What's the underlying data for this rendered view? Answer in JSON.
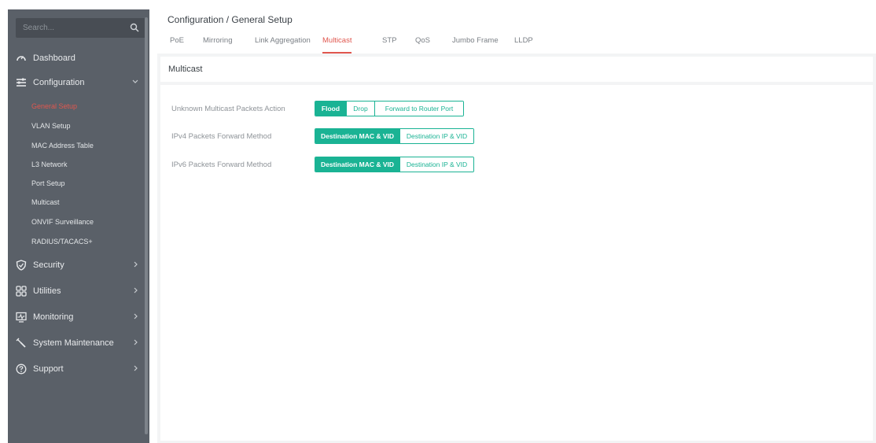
{
  "sidebar": {
    "search_placeholder": "Search...",
    "items": [
      {
        "label": "Dashboard",
        "icon": "dashboard-gauge-icon"
      },
      {
        "label": "Configuration",
        "icon": "list-settings-icon",
        "expanded": true
      },
      {
        "label": "Security",
        "icon": "shield-icon"
      },
      {
        "label": "Utilities",
        "icon": "grid-icon"
      },
      {
        "label": "Monitoring",
        "icon": "monitor-icon"
      },
      {
        "label": "System Maintenance",
        "icon": "wrench-icon"
      },
      {
        "label": "Support",
        "icon": "help-icon"
      }
    ],
    "config_subitems": [
      {
        "label": "General Setup",
        "active": true
      },
      {
        "label": "VLAN Setup"
      },
      {
        "label": "MAC Address Table"
      },
      {
        "label": "L3 Network"
      },
      {
        "label": "Port Setup"
      },
      {
        "label": "Multicast"
      },
      {
        "label": "ONVIF Surveillance"
      },
      {
        "label": "RADIUS/TACACS+"
      }
    ]
  },
  "header": {
    "breadcrumb": "Configuration / General Setup"
  },
  "tabs": [
    {
      "label": "PoE"
    },
    {
      "label": "Mirroring"
    },
    {
      "label": "Link Aggregation"
    },
    {
      "label": "Multicast",
      "active": true
    },
    {
      "label": "STP"
    },
    {
      "label": "QoS"
    },
    {
      "label": "Jumbo Frame"
    },
    {
      "label": "LLDP"
    }
  ],
  "panel": {
    "title": "Multicast",
    "rows": [
      {
        "label": "Unknown Multicast Packets Action",
        "options": [
          "Flood",
          "Drop",
          "Forward to Router Port"
        ],
        "selected": "Flood"
      },
      {
        "label": "IPv4 Packets Forward Method",
        "options": [
          "Destination MAC & VID",
          "Destination IP & VID"
        ],
        "selected": "Destination MAC & VID"
      },
      {
        "label": "IPv6 Packets Forward Method",
        "options": [
          "Destination MAC & VID",
          "Destination IP & VID"
        ],
        "selected": "Destination MAC & VID"
      }
    ]
  },
  "colors": {
    "accent": "#1ab394",
    "active_red": "#e0574f",
    "sidebar_bg": "#5a6068"
  }
}
